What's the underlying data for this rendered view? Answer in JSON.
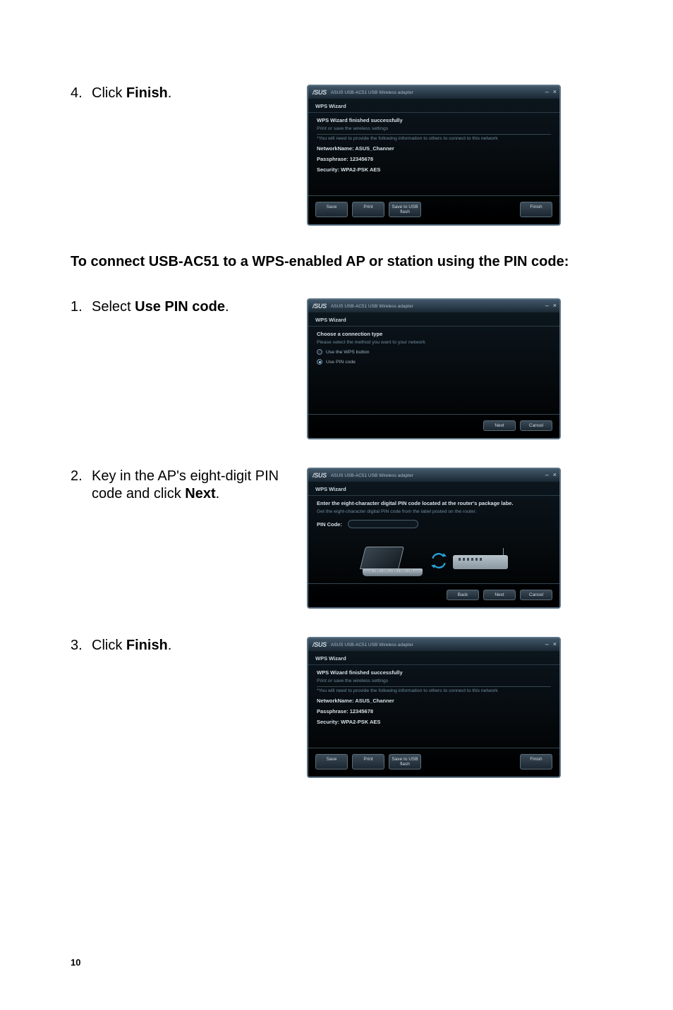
{
  "page_number": "10",
  "step4_num": "4.",
  "step4_pre": "Click ",
  "step4_bold": "Finish",
  "step4_post": ".",
  "heading": "To connect USB-AC51 to a WPS-enabled AP or station using the PIN code:",
  "step1_num": "1.",
  "step1_pre": "Select ",
  "step1_bold": "Use PIN code",
  "step1_post": ".",
  "step2_num": "2.",
  "step2_pre": "Key in the AP's eight-digit PIN code and click ",
  "step2_bold": "Next",
  "step2_post": ".",
  "step3_num": "3.",
  "step3_pre": "Click ",
  "step3_bold": "Finish",
  "step3_post": ".",
  "wiz": {
    "logo": "/SUS",
    "title": "ASUS USB-AC51 USB Wireless adapter",
    "crumb": "WPS Wizard",
    "min": "–",
    "close": "×"
  },
  "wiz_finish": {
    "heading": "WPS Wizard finished successfully",
    "sub": "Print or save the wireless settings",
    "note": "*You will need to provide the following information to others to connect to this network",
    "net": "NetworkName: ASUS_Channer",
    "pass": "Passphrase: 12345678",
    "sec": "Security: WPA2-PSK AES",
    "btn_save": "Save",
    "btn_print": "Print",
    "btn_usb": "Save to USB\nflash",
    "btn_finish": "Finish"
  },
  "wiz_choose": {
    "heading": "Choose a connection type",
    "sub": "Please select the method you want to your network",
    "opt1": "Use the WPS button",
    "opt2": "Use PIN code",
    "btn_next": "Next",
    "btn_cancel": "Cancel"
  },
  "wiz_pin": {
    "heading": "Enter the eight-character digital PIN code located at the router's package labe.",
    "sub": "Get the eight-character digital PIN code from the label posted on the router.",
    "label": "PIN Code:",
    "btn_back": "Back",
    "btn_next": "Next",
    "btn_cancel": "Cancel"
  }
}
